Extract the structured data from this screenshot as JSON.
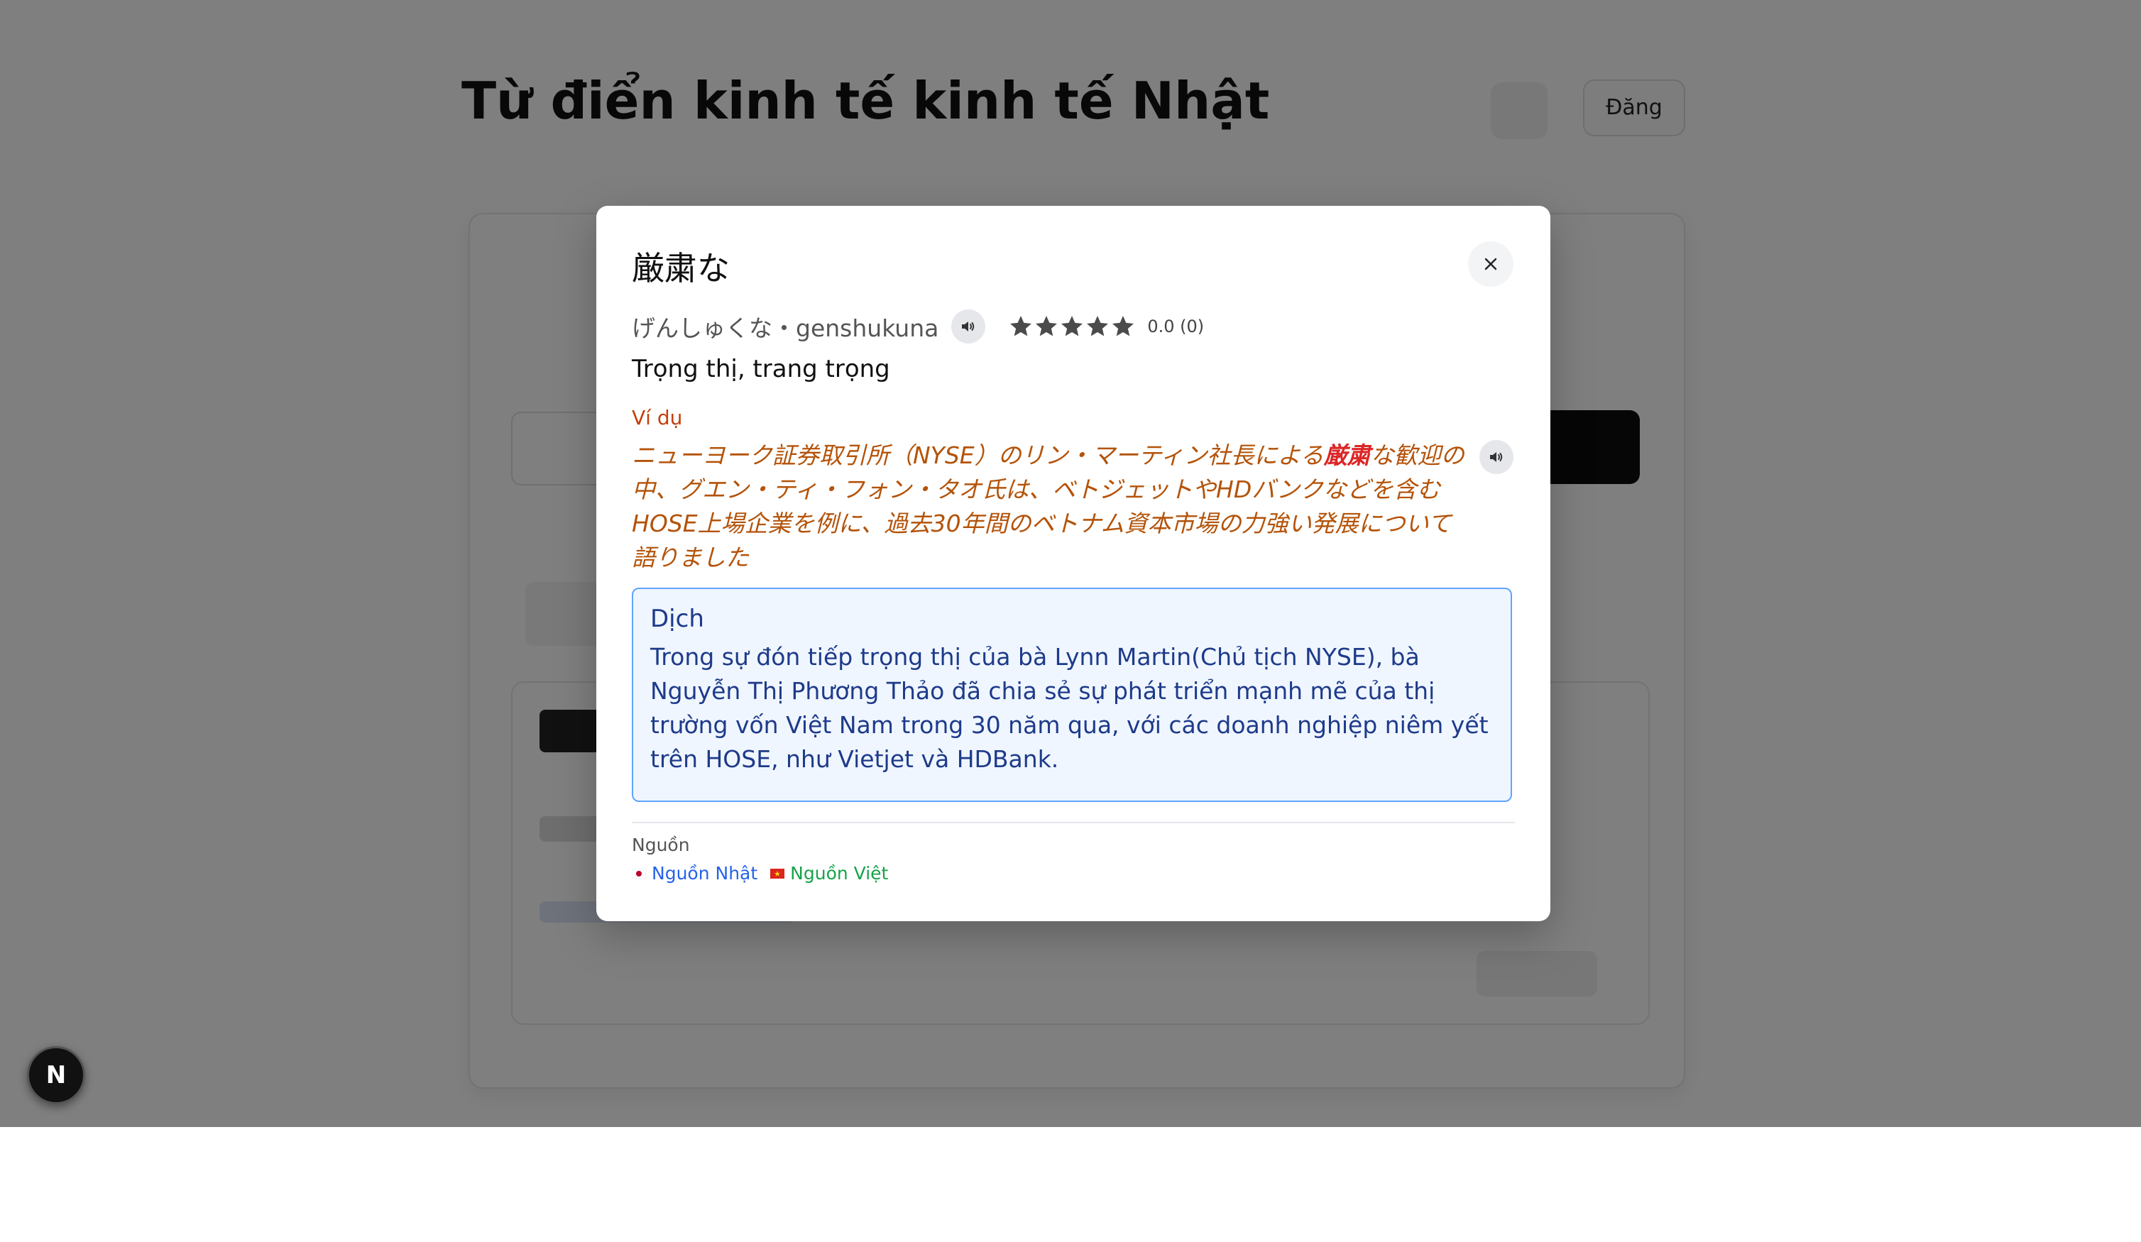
{
  "background": {
    "title": "Từ điển kinh tế kinh tế Nhật",
    "login_label": "Đăng"
  },
  "modal": {
    "title": "厳粛な",
    "reading": "げんしゅくな・genshukuna",
    "rating": {
      "stars": 5,
      "text": "0.0 (0)"
    },
    "meaning": "Trọng thị, trang trọng",
    "example_label": "Ví dụ",
    "example": {
      "before": "ニューヨーク証券取引所（NYSE）のリン・マーティン社長による",
      "highlight": "厳粛",
      "after": "な歓迎の中、グエン・ティ・フォン・タオ氏は、ベトジェットやHDバンクなどを含むHOSE上場企業を例に、過去30年間のベトナム資本市場の力強い発展について語りました"
    },
    "translation_label": "Dịch",
    "translation": "Trong sự đón tiếp trọng thị của bà Lynn Martin(Chủ tịch NYSE), bà Nguyễn Thị Phương Thảo đã chia sẻ sự phát triển mạnh mẽ của thị trường vốn Việt Nam trong 30 năm qua, với các doanh nghiệp niêm yết trên HOSE, như Vietjet và HDBank.",
    "source_label": "Nguồn",
    "sources": {
      "jp": "Nguồn Nhật",
      "vn": "Nguồn Việt"
    }
  },
  "badge": {
    "letter": "N"
  },
  "colors": {
    "example": "#b45309",
    "highlight": "#dc2626",
    "translation_bg": "#eff6ff",
    "translation_border": "#60a5fa",
    "link_jp": "#2563eb",
    "link_vn": "#16a34a"
  }
}
